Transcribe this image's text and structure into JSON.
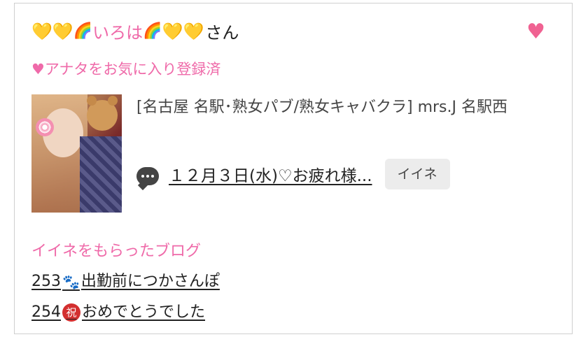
{
  "profile": {
    "name_prefix": "💛💛",
    "name_rainbow": "🌈",
    "name": "いろは",
    "name_rainbow2": "🌈",
    "name_suffix_hearts": "💛💛",
    "honorific": "さん",
    "fav_icon": "heart-icon",
    "fav_status": "♥アナタをお気に入り登録済"
  },
  "shop": {
    "name": "[名古屋 名駅･熟女パブ/熟女キャバクラ]  mrs.J 名駅西"
  },
  "latest_blog": {
    "icon": "chat-bubble-icon",
    "title": "１２月３日(水)♡お疲れ様...",
    "iine_label": "イイネ"
  },
  "liked_blogs": {
    "label": "イイネをもらったブログ",
    "items": [
      {
        "number": "253",
        "icon": "🐾",
        "title": "出勤前につかさんぽ"
      },
      {
        "number": "254",
        "icon": "祝",
        "title": "おめでとうでした"
      }
    ]
  },
  "colors": {
    "accent_pink": "#ef6aa9",
    "fav_heart": "#f06292",
    "button_bg": "#ececec"
  }
}
